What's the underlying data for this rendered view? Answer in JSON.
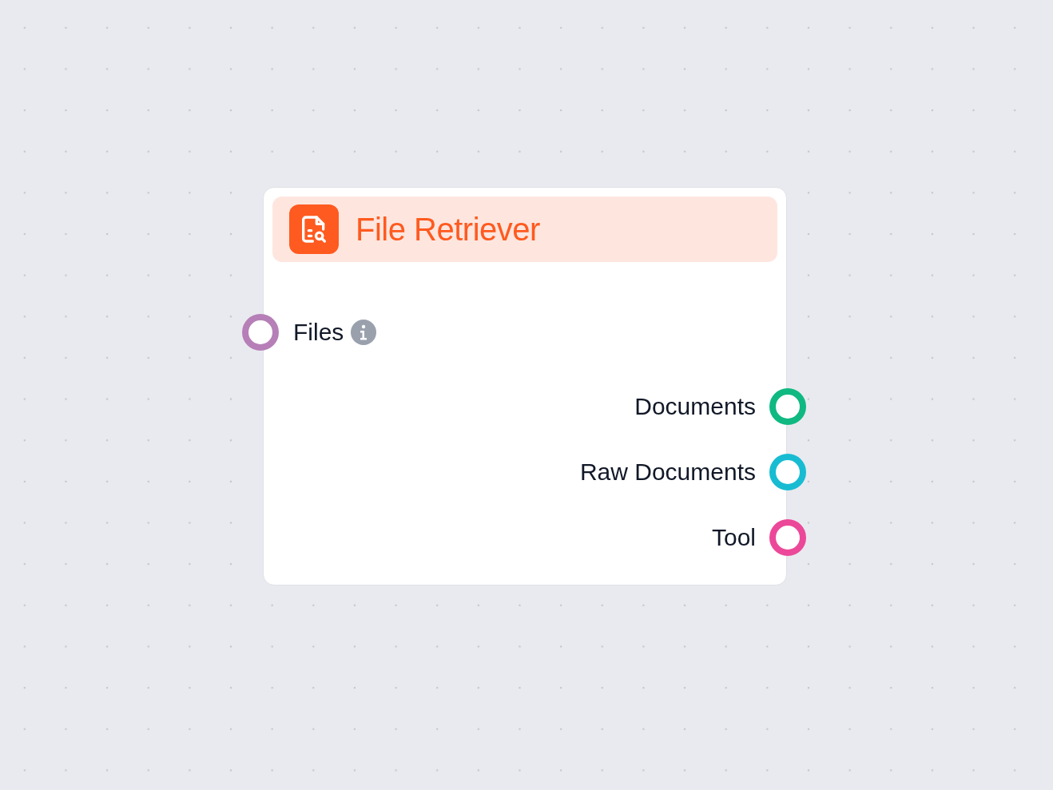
{
  "node": {
    "title": "File Retriever",
    "inputs": [
      {
        "label": "Files",
        "color": "#b67fb7",
        "info": true
      }
    ],
    "outputs": [
      {
        "label": "Documents",
        "color": "#10b981"
      },
      {
        "label": "Raw Documents",
        "color": "#17bcd2"
      },
      {
        "label": "Tool",
        "color": "#ec4899"
      }
    ]
  }
}
